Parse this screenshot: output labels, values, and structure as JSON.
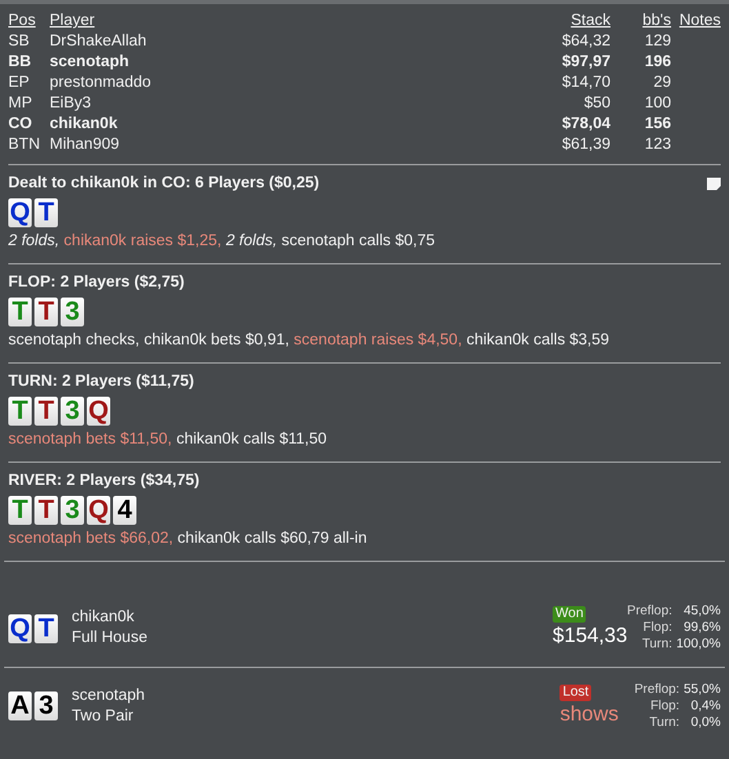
{
  "players_table": {
    "columns": [
      "Pos",
      "Player",
      "Stack",
      "bb's",
      "Notes"
    ],
    "rows": [
      {
        "pos": "SB",
        "player": "DrShakeAllah",
        "stack": "$64,32",
        "bbs": "129",
        "bold": false
      },
      {
        "pos": "BB",
        "player": "scenotaph",
        "stack": "$97,97",
        "bbs": "196",
        "bold": true
      },
      {
        "pos": "EP",
        "player": "prestonmaddo",
        "stack": "$14,70",
        "bbs": "29",
        "bold": false
      },
      {
        "pos": "MP",
        "player": "EiBy3",
        "stack": "$50",
        "bbs": "100",
        "bold": false
      },
      {
        "pos": "CO",
        "player": "chikan0k",
        "stack": "$78,04",
        "bbs": "156",
        "bold": true
      },
      {
        "pos": "BTN",
        "player": "Mihan909",
        "stack": "$61,39",
        "bbs": "123",
        "bold": false
      }
    ]
  },
  "streets": [
    {
      "title": "Dealt to chikan0k in CO: 6 Players ($0,25)",
      "note_icon": true,
      "cards": [
        {
          "rank": "Q",
          "color": "#0a2ecc"
        },
        {
          "rank": "T",
          "color": "#0a2ecc"
        }
      ],
      "actions": [
        {
          "text": "2 folds,",
          "kind": "fold"
        },
        {
          "text": "chikan0k raises $1,25,",
          "kind": "aggressive"
        },
        {
          "text": "2 folds,",
          "kind": "fold"
        },
        {
          "text": "scenotaph calls $0,75",
          "kind": "plain"
        }
      ]
    },
    {
      "title": "FLOP: 2 Players ($2,75)",
      "cards": [
        {
          "rank": "T",
          "color": "#1a8a1a"
        },
        {
          "rank": "T",
          "color": "#a01818"
        },
        {
          "rank": "3",
          "color": "#1a8a1a"
        }
      ],
      "actions": [
        {
          "text": "scenotaph checks, chikan0k bets $0,91,",
          "kind": "plain"
        },
        {
          "text": "scenotaph raises $4,50,",
          "kind": "aggressive"
        },
        {
          "text": "chikan0k calls $3,59",
          "kind": "plain"
        }
      ]
    },
    {
      "title": "TURN: 2 Players ($11,75)",
      "cards": [
        {
          "rank": "T",
          "color": "#1a8a1a"
        },
        {
          "rank": "T",
          "color": "#a01818"
        },
        {
          "rank": "3",
          "color": "#1a8a1a"
        },
        {
          "rank": "Q",
          "color": "#a01818"
        }
      ],
      "actions": [
        {
          "text": "scenotaph bets $11,50,",
          "kind": "aggressive"
        },
        {
          "text": "chikan0k calls $11,50",
          "kind": "plain"
        }
      ]
    },
    {
      "title": "RIVER: 2 Players ($34,75)",
      "cards": [
        {
          "rank": "T",
          "color": "#1a8a1a"
        },
        {
          "rank": "T",
          "color": "#a01818"
        },
        {
          "rank": "3",
          "color": "#1a8a1a"
        },
        {
          "rank": "Q",
          "color": "#a01818"
        },
        {
          "rank": "4",
          "color": "#000000"
        }
      ],
      "actions": [
        {
          "text": "scenotaph bets $66,02,",
          "kind": "aggressive"
        },
        {
          "text": "chikan0k calls $60,79 all-in",
          "kind": "plain"
        }
      ]
    }
  ],
  "showdown": [
    {
      "cards": [
        {
          "rank": "Q",
          "color": "#0a2ecc"
        },
        {
          "rank": "T",
          "color": "#0a2ecc"
        }
      ],
      "player": "chikan0k",
      "hand": "Full House",
      "result": "Won",
      "won": true,
      "amount": "$154,33",
      "equity": [
        {
          "label": "Preflop:",
          "value": "45,0%"
        },
        {
          "label": "Flop:",
          "value": "99,6%"
        },
        {
          "label": "Turn:",
          "value": "100,0%"
        }
      ]
    },
    {
      "cards": [
        {
          "rank": "A",
          "color": "#000000"
        },
        {
          "rank": "3",
          "color": "#000000"
        }
      ],
      "player": "scenotaph",
      "hand": "Two Pair",
      "result": "Lost",
      "won": false,
      "amount": "shows",
      "equity": [
        {
          "label": "Preflop:",
          "value": "55,0%"
        },
        {
          "label": "Flop:",
          "value": "0,4%"
        },
        {
          "label": "Turn:",
          "value": "0,0%"
        }
      ]
    }
  ]
}
